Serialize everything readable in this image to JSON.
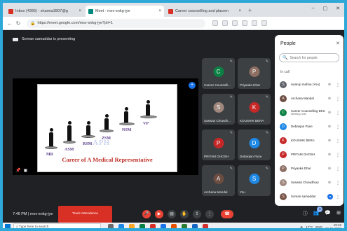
{
  "browser": {
    "tabs": [
      {
        "title": "Inbox (4395) - sharma3807@g",
        "favicon_color": "#d93025",
        "active": false
      },
      {
        "title": "Meet - mxv-snkg-jye",
        "favicon_color": "#00897b",
        "active": true
      },
      {
        "title": "Career counselling and placem",
        "favicon_color": "#d93025",
        "active": false
      }
    ],
    "new_tab": "+",
    "url": "https://meet.google.com/mxv-snkg-jye?pli=1"
  },
  "meet": {
    "presenting_text": "Soman samaddar is presenting",
    "slide": {
      "watermark": "APH",
      "caption": "Career of A Medical Representative",
      "levels": [
        "MR",
        "ASM",
        "RSM",
        "ZSM",
        "NSM",
        "VP"
      ]
    },
    "tiles": [
      {
        "name": "Career Counselli...",
        "initial": "C",
        "color": "#0b8043"
      },
      {
        "name": "Priyanka Dhar",
        "initial": "P",
        "color": "#8d6e63"
      },
      {
        "name": "Saswati Chowdh...",
        "initial": "S",
        "color": "#a1887f"
      },
      {
        "name": "KOUSHIK BERA",
        "initial": "K",
        "color": "#c62828"
      },
      {
        "name": "PRITAM GHOSH",
        "initial": "P",
        "color": "#c62828"
      },
      {
        "name": "Debanjan Pyne",
        "initial": "D",
        "color": "#1e88e5"
      },
      {
        "name": "Archana Mandal",
        "initial": "A",
        "color": "#6d4c41"
      },
      {
        "name": "You",
        "initial": "S",
        "color": "#1e88e5"
      }
    ],
    "people": {
      "title": "People",
      "search_placeholder": "Search for people",
      "section": "In call",
      "list": [
        {
          "name": "swarup mahna (You)",
          "sub": "",
          "initial": "S",
          "color": "#5f6368"
        },
        {
          "name": "Archana Mandal",
          "sub": "",
          "initial": "A",
          "color": "#6d4c41"
        },
        {
          "name": "Career Counselling BKC",
          "sub": "Meeting host",
          "initial": "C",
          "color": "#0b8043"
        },
        {
          "name": "Debanjan Pyne",
          "sub": "",
          "initial": "D",
          "color": "#1e88e5"
        },
        {
          "name": "KOUSHIK BERA",
          "sub": "",
          "initial": "K",
          "color": "#c62828"
        },
        {
          "name": "PRITAM GHOSH",
          "sub": "",
          "initial": "P",
          "color": "#c62828"
        },
        {
          "name": "Priyanka Dhar",
          "sub": "",
          "initial": "P",
          "color": "#8d6e63"
        },
        {
          "name": "Saswati Chowdhury",
          "sub": "",
          "initial": "S",
          "color": "#a1887f"
        },
        {
          "name": "Soman samaddar",
          "sub": "",
          "initial": "S",
          "color": "#795548"
        }
      ]
    },
    "clock": "7:46 PM",
    "meeting_code": "mxv-snkg-jye",
    "track_label": "Track Attendance",
    "participant_count": "9"
  },
  "taskbar": {
    "search_placeholder": "Type here to search",
    "temperature": "17°C",
    "language": "ENG",
    "time": "19:46",
    "date": "20-01-2022"
  }
}
